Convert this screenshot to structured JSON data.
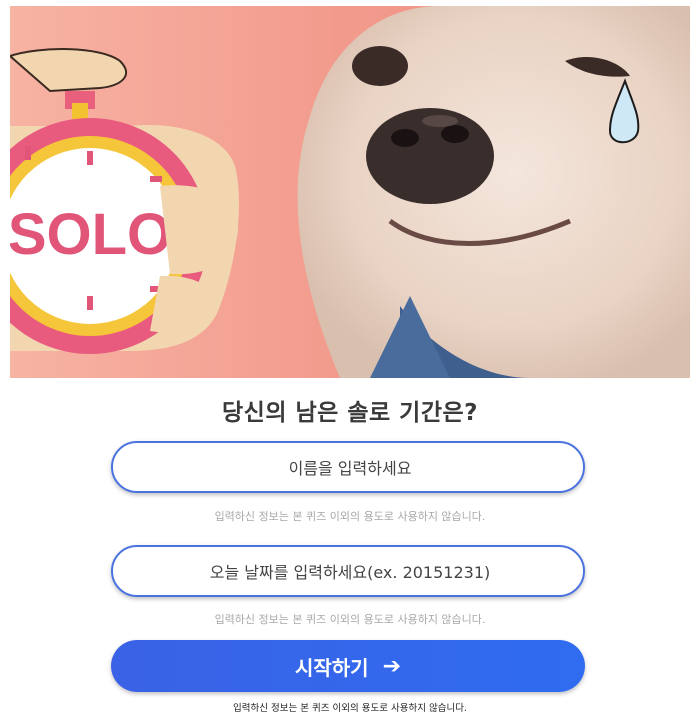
{
  "hero": {
    "stopwatch_text": "SOLO",
    "image_icon": "crying-dog-illustration"
  },
  "title": "당신의 남은 솔로 기간은?",
  "name_field": {
    "value": "",
    "placeholder": "이름을 입력하세요"
  },
  "date_field": {
    "value": "",
    "placeholder": "오늘 날짜를 입력하세요(ex. 20151231)"
  },
  "notice_text": "입력하신 정보는 본 퀴즈 이외의 용도로 사용하지 않습니다.",
  "start_button": {
    "label": "시작하기",
    "icon": "arrow-right-icon"
  },
  "footer_notice": "입력하신 정보는 본 퀴즈 이외의 용도로 사용하지 않습니다.",
  "colors": {
    "accent": "#3a62e6",
    "border": "#4a72e0",
    "title": "#3a3a3a"
  }
}
